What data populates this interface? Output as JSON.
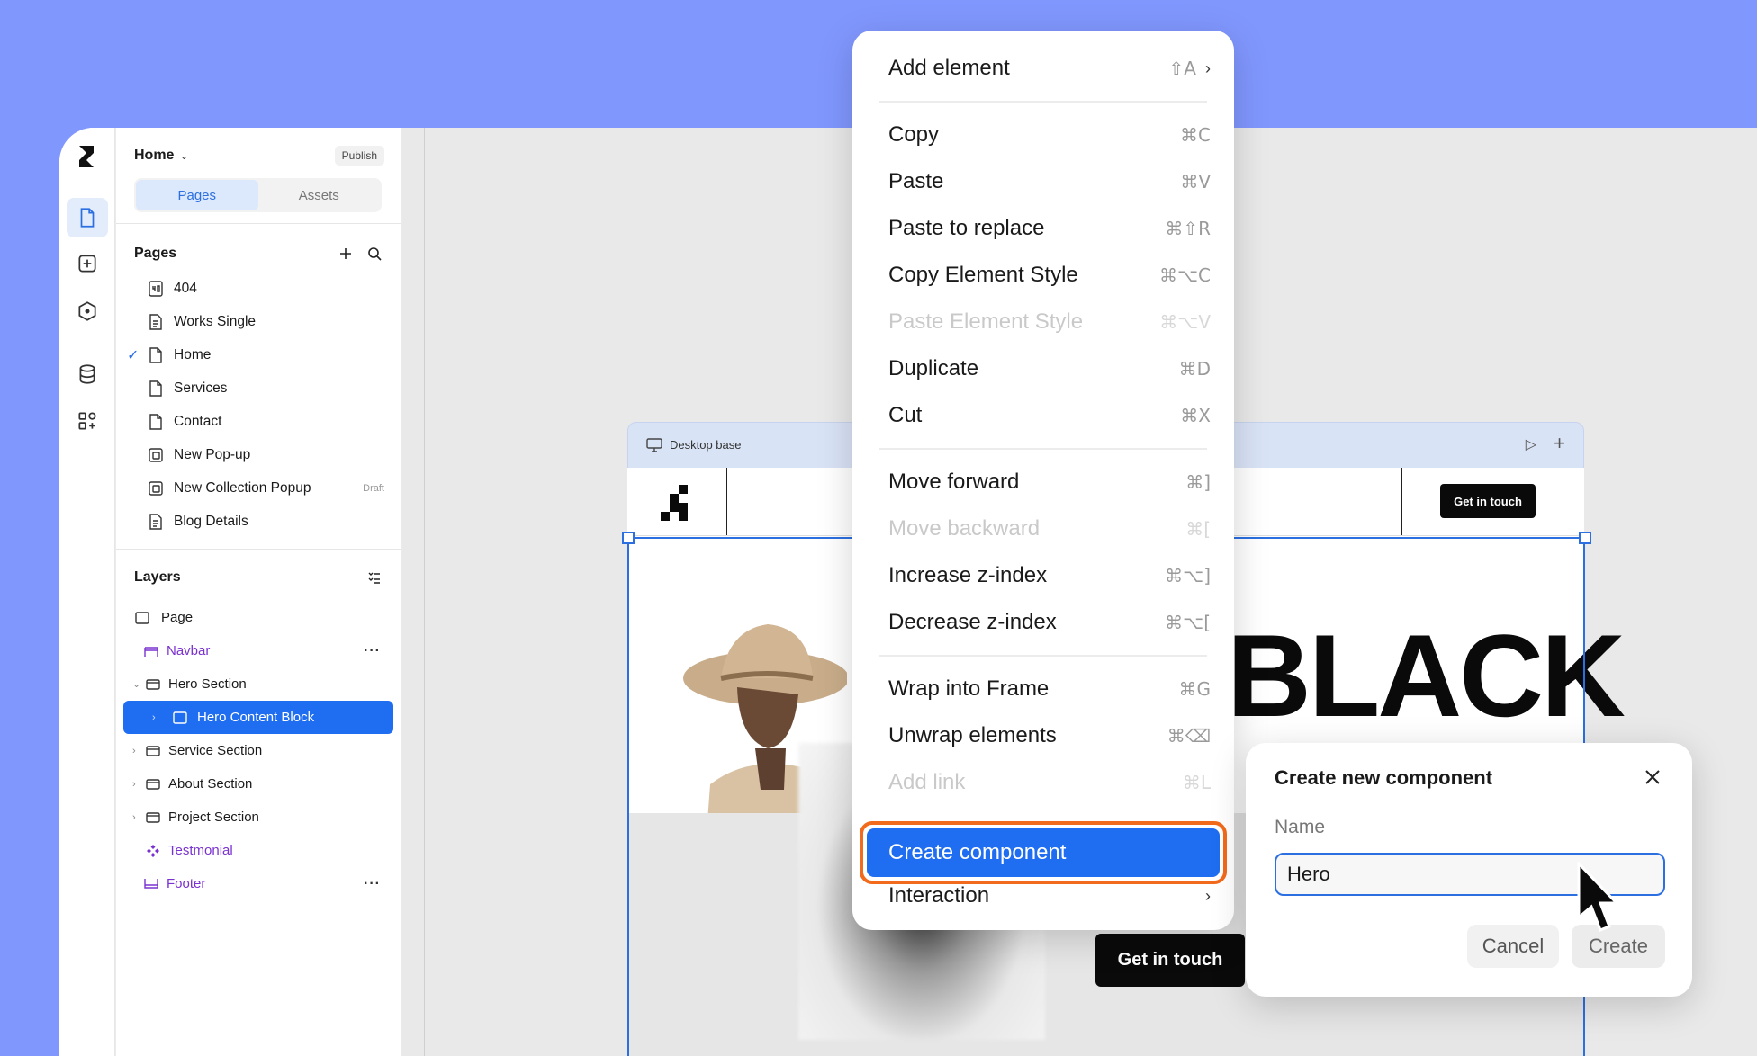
{
  "header": {
    "title": "Home",
    "publish_label": "Publish"
  },
  "tabs": {
    "pages": "Pages",
    "assets": "Assets"
  },
  "pages_section": {
    "title": "Pages",
    "items": [
      {
        "label": "404",
        "checked": false,
        "icon": "page-404-icon"
      },
      {
        "label": "Works Single",
        "checked": false,
        "icon": "page-template-icon"
      },
      {
        "label": "Home",
        "checked": true,
        "icon": "page-icon"
      },
      {
        "label": "Services",
        "checked": false,
        "icon": "page-icon"
      },
      {
        "label": "Contact",
        "checked": false,
        "icon": "page-icon"
      },
      {
        "label": "New Pop-up",
        "checked": false,
        "icon": "popup-icon"
      },
      {
        "label": "New Collection Popup",
        "checked": false,
        "icon": "popup-icon",
        "badge": "Draft"
      },
      {
        "label": "Blog Details",
        "checked": false,
        "icon": "page-template-icon"
      }
    ]
  },
  "layers_section": {
    "title": "Layers",
    "items": [
      {
        "label": "Page"
      },
      {
        "label": "Navbar"
      },
      {
        "label": "Hero Section"
      },
      {
        "label": "Hero Content Block"
      },
      {
        "label": "Service Section"
      },
      {
        "label": "About Section"
      },
      {
        "label": "Project Section"
      },
      {
        "label": "Testmonial"
      },
      {
        "label": "Footer"
      }
    ]
  },
  "canvas": {
    "frame_label": "Desktop base",
    "nav_button": "Get in touch",
    "hero_text": "BLACK",
    "hero_button": "Get in touch"
  },
  "context_menu": {
    "items": [
      {
        "label": "Add element",
        "shortcut": "⇧A",
        "submenu": true
      },
      {
        "label": "Copy",
        "shortcut": "⌘C"
      },
      {
        "label": "Paste",
        "shortcut": "⌘V"
      },
      {
        "label": "Paste to replace",
        "shortcut": "⌘⇧R"
      },
      {
        "label": "Copy Element Style",
        "shortcut": "⌘⌥C"
      },
      {
        "label": "Paste Element Style",
        "shortcut": "⌘⌥V",
        "disabled": true
      },
      {
        "label": "Duplicate",
        "shortcut": "⌘D"
      },
      {
        "label": "Cut",
        "shortcut": "⌘X"
      },
      {
        "label": "Move forward",
        "shortcut": "⌘]"
      },
      {
        "label": "Move backward",
        "shortcut": "⌘[",
        "disabled": true
      },
      {
        "label": "Increase z-index",
        "shortcut": "⌘⌥]"
      },
      {
        "label": "Decrease z-index",
        "shortcut": "⌘⌥["
      },
      {
        "label": "Wrap into Frame",
        "shortcut": "⌘G"
      },
      {
        "label": "Unwrap elements",
        "shortcut": "⌘⌫"
      },
      {
        "label": "Add link",
        "shortcut": "⌘L",
        "disabled": true
      },
      {
        "label": "Create component",
        "highlighted": true
      },
      {
        "label": "Interaction",
        "submenu": true
      }
    ]
  },
  "dialog": {
    "title": "Create new component",
    "name_label": "Name",
    "name_value": "Hero",
    "cancel_label": "Cancel",
    "create_label": "Create"
  },
  "colors": {
    "background": "#8097fe",
    "accent": "#1f6df0",
    "highlight_outline": "#f26a1b",
    "component_purple": "#7a32d0"
  }
}
